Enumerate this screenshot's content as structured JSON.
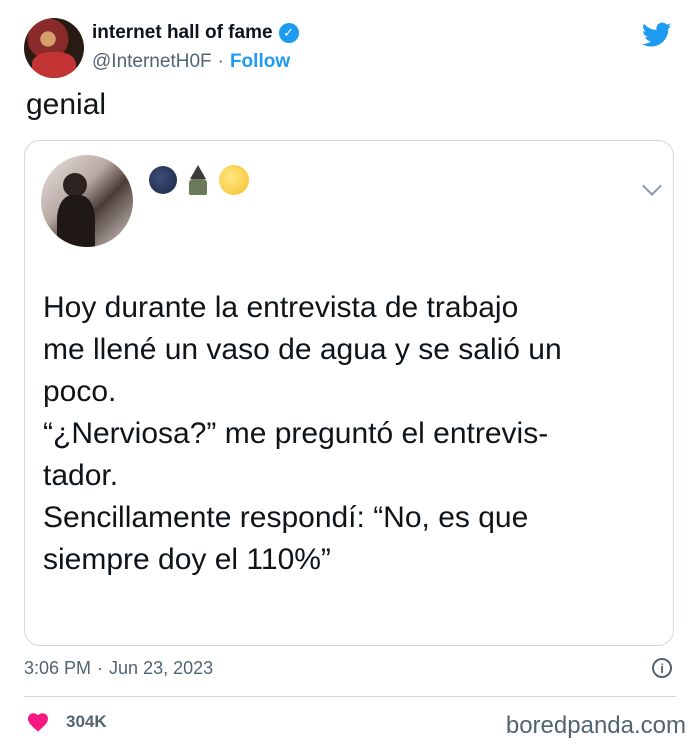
{
  "author": {
    "name": "internet hall of fame",
    "handle": "@InternetH0F",
    "follow_label": "Follow",
    "separator": "·"
  },
  "tweet": {
    "text": "genial"
  },
  "quoted_tweet": {
    "text": "Hoy durante la entrevista de trabajo\nme llené un vaso de agua y se salió un\npoco.\n“¿Nerviosa?” me preguntó el entrevis-\ntador.\nSencillamente respondí: “No, es que\nsiempre doy el 110%”"
  },
  "meta": {
    "time": "3:06 PM",
    "separator": "·",
    "date": "Jun 23, 2023"
  },
  "engagement": {
    "likes": "304K"
  },
  "watermark": "boredpanda.com",
  "icons": {
    "verified": "verified-badge-icon",
    "brand": "twitter-bird-icon",
    "info": "info-icon",
    "like": "heart-icon",
    "expand": "chevron-down-icon"
  },
  "colors": {
    "accent": "#1d9bf0",
    "heart": "#f91880",
    "muted": "#536471",
    "border": "#cfd9de"
  }
}
